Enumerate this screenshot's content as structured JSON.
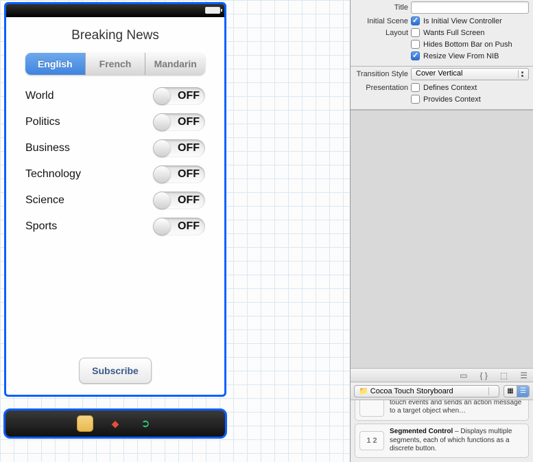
{
  "phone": {
    "title": "Breaking News",
    "segments": [
      "English",
      "French",
      "Mandarin"
    ],
    "selectedSegment": 0,
    "rows": [
      {
        "label": "World",
        "state": "OFF"
      },
      {
        "label": "Politics",
        "state": "OFF"
      },
      {
        "label": "Business",
        "state": "OFF"
      },
      {
        "label": "Technology",
        "state": "OFF"
      },
      {
        "label": "Science",
        "state": "OFF"
      },
      {
        "label": "Sports",
        "state": "OFF"
      }
    ],
    "subscribe": "Subscribe"
  },
  "inspector": {
    "title_label": "Title",
    "title_value": "",
    "initial_scene_label": "Initial Scene",
    "is_initial": {
      "label": "Is Initial View Controller",
      "checked": true
    },
    "layout_label": "Layout",
    "wants_full": {
      "label": "Wants Full Screen",
      "checked": false
    },
    "hides_bottom": {
      "label": "Hides Bottom Bar on Push",
      "checked": false
    },
    "resize_nib": {
      "label": "Resize View From NIB",
      "checked": true
    },
    "transition_style_label": "Transition Style",
    "transition_style_value": "Cover Vertical",
    "presentation_label": "Presentation",
    "defines_context": {
      "label": "Defines Context",
      "checked": false
    },
    "provides_context": {
      "label": "Provides Context",
      "checked": false
    }
  },
  "library": {
    "popup": "Cocoa Touch Storyboard",
    "items": [
      {
        "thumb": "",
        "title": "",
        "desc": "touch events and sends an action message to a target object when…"
      },
      {
        "thumb": "1 2",
        "title": "Segmented Control",
        "desc": " – Displays multiple segments, each of which functions as a discrete button."
      }
    ]
  }
}
